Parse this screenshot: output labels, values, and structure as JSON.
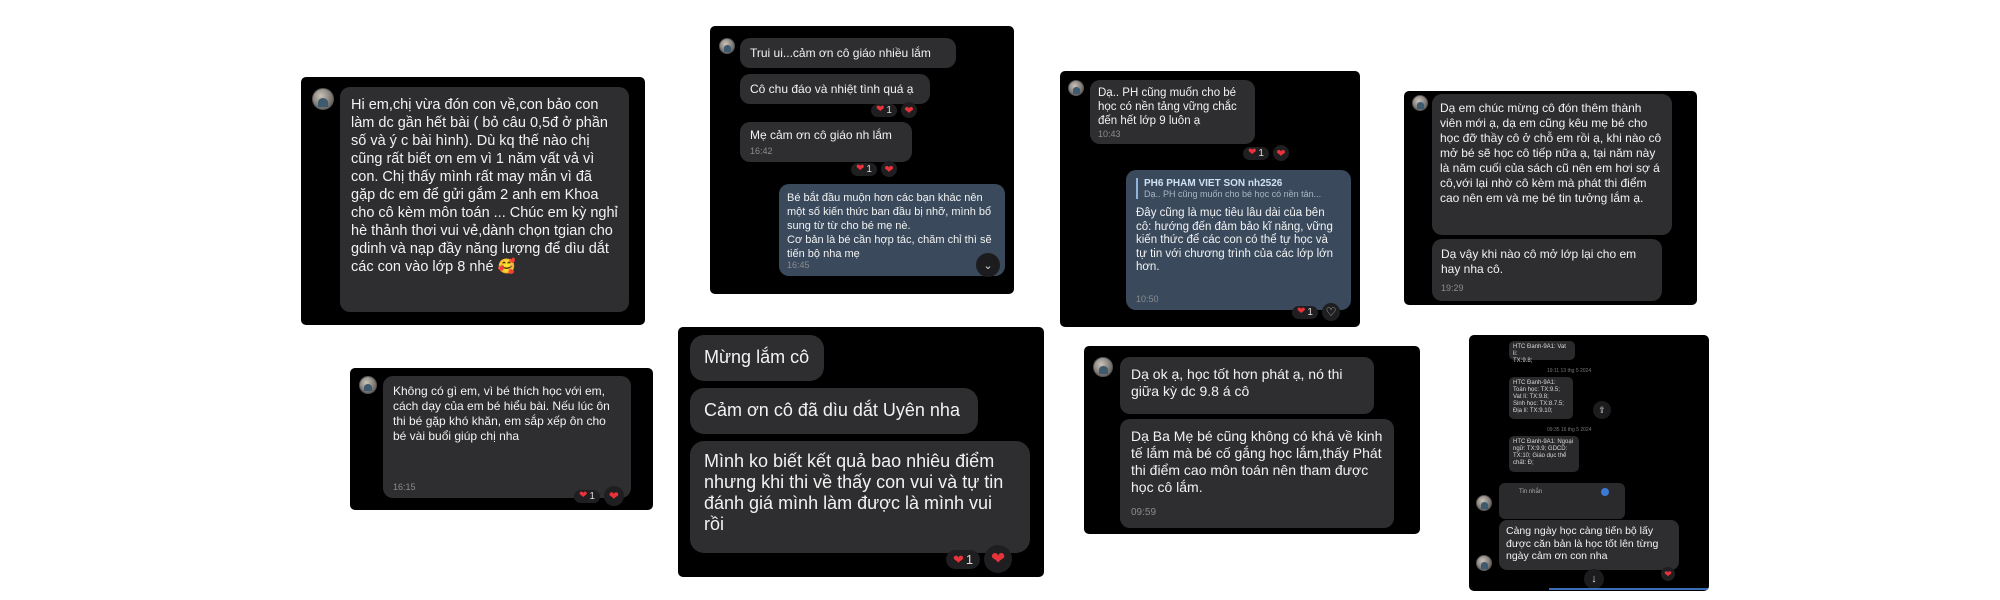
{
  "colors": {
    "card_bg": "#000000",
    "bubble": "#2e2e30",
    "bubble_sent": "#3a4a5c",
    "heart": "#e8333b",
    "timestamp": "#8b8b8f"
  },
  "icons": {
    "reaction": "heart-icon",
    "scroll": "chevron-down-icon",
    "share": "share-icon",
    "avatar": "avatar"
  },
  "card1": {
    "message": "Hi em,chị vừa đón con về,con bảo con làm dc gần hết bài ( bỏ câu 0,5đ ở phần số và ý c bài hình). Dù kq thế nào chị cũng rất biết ơn em vì 1 năm vất vả vì con. Chị thấy mình rất may mắn vì đã gặp dc em để gửi gắm 2 anh em Khoa cho cô kèm môn toán ... Chúc em kỳ nghỉ hè thảnh thơi vui vẻ,dành chọn tgian cho gdinh và nạp đầy năng lượng để dìu dắt các con vào lớp 8 nhé 🥰"
  },
  "card2": {
    "msg1": "Trui ui...cảm ơn cô giáo nhiều lắm",
    "msg2": "Cô chu đáo và nhiệt tình quá ạ",
    "msg2_count": "1",
    "msg3": "Mẹ cảm ơn cô giáo nh lắm",
    "msg3_time": "16:42",
    "msg3_count": "1",
    "msg4": "Bé bắt đầu muộn hơn các bạn khác nên một số kiến thức ban đầu bị nhỡ, mình bổ sung từ từ cho bé mẹ nè.\nCơ bản là bé cần hợp tác, chăm chỉ thì sẽ tiến bộ nha mẹ",
    "msg4_time": "16:45"
  },
  "card3": {
    "msg1": "Dạ.. PH cũng muốn cho bé học có nền tảng vững chắc đến hết lớp 9 luôn ạ",
    "msg1_time": "10:43",
    "msg1_count": "1",
    "reply_name": "PH6 PHAM VIET SON nh2526",
    "reply_snippet": "Dạ.. PH cũng muốn cho bé học có nền tản...",
    "reply_text": "Đây cũng là mục tiêu lâu dài của bên cô: hướng đến đảm bảo kĩ năng, vững kiến thức để các con có thể tự học và tự tin với chương trình của các lớp lớn hơn.",
    "reply_time": "10:50",
    "reply_count": "1"
  },
  "card4": {
    "msg1": "Dạ em chúc mừng cô đón thêm thành viên mới ạ, dạ em cũng kêu mẹ bé cho học đỡ thầy cô ở chỗ em rồi ạ, khi nào cô mở bé sẽ học cô tiếp nữa ạ, tại năm này là năm cuối của sách cũ nên em hơi sợ á cô,với lại nhờ cô kèm mà phát thi điểm cao nên em và mẹ bé tin tưởng lắm ạ.",
    "msg2": "Dạ vậy khi nào cô mở lớp lại cho em hay nha cô.",
    "msg2_time": "19:29"
  },
  "card5": {
    "message": "Không có gì em, vì bé thích học với em, cách dạy của em bé hiểu bài. Nếu lúc ôn thi bé gặp khó khăn,  em sắp xếp ôn cho bé vài buổi giúp chị nha",
    "time": "16:15",
    "count": "1"
  },
  "card6": {
    "msg1": "Mừng lắm cô",
    "msg2": "Cảm ơn cô đã dìu dắt Uyên nha",
    "msg3": "Mình ko biết kết quả bao nhiêu điểm nhưng khi thi về thấy con vui và tự tin đánh giá mình làm được là mình vui rồi",
    "msg3_count": "1"
  },
  "card7": {
    "msg1": "Dạ ok ạ, học tốt hơn phát ạ, nó thi giữa kỳ  dc 9.8 á cô",
    "msg2": "Dạ Ba Mẹ bé cũng không có khá về kinh tế lắm mà bé cố gắng học lắm,thấy Phát thi điểm cao môn toán nên tham được học cô lắm.",
    "msg2_time": "09:59"
  },
  "card8": {
    "mini1": "HTC Đanh-9A1: Vat li:\nTX:9.8;",
    "date1": "19:11 13 thg 5 2024",
    "mini2": "HTC Đanh-9A1:\nToán học: TX:9.5;\nVat lí: TX:9.8;\nSinh học: TX:8.7.5;\nĐịa lí: TX:9.10;",
    "date2": "09:35 16 thg 5 2024",
    "mini3": "HTC Đanh-9A1: Ngoại\nngữ: TX:9.9; GDCD:\nTX:10; Giáo dục thể\nchất: Đ;",
    "input_text": "Tin nhắn",
    "message": "Càng ngày học càng tiến bộ lấy được căn bản là học tốt lên từng ngày cảm ơn con nha"
  }
}
